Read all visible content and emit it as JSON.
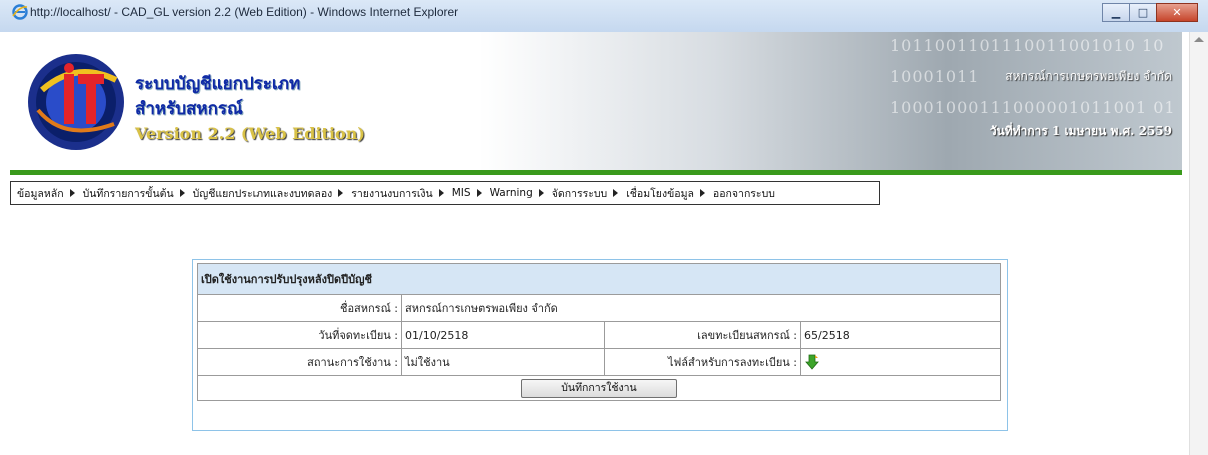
{
  "window": {
    "title": "http://localhost/ - CAD_GL version 2.2 (Web Edition) - Windows Internet Explorer",
    "controls": [
      "minimize",
      "maximize",
      "close"
    ]
  },
  "banner": {
    "title_line1": "ระบบบัญชีแยกประเภท",
    "title_line2": "สำหรับสหกรณ์",
    "version": "Version 2.2 (Web Edition)",
    "binary_row1": "1011001101110011001010 10",
    "binary_row2": "10001011",
    "binary_row3": "10001000111000001011001 01",
    "coop_name": "สหกรณ์การเกษตรพอเพียง จำกัด",
    "work_date": "วันที่ทำการ 1 เมษายน พ.ศ. 2559"
  },
  "menu": {
    "items": [
      "ข้อมูลหลัก",
      "บันทึกรายการขั้นต้น",
      "บัญชีแยกประเภทและงบทดลอง",
      "รายงานงบการเงิน",
      "MIS",
      "Warning",
      "จัดการระบบ",
      "เชื่อมโยงข้อมูล",
      "ออกจากระบบ"
    ]
  },
  "panel": {
    "title": "เปิดใช้งานการปรับปรุงหลังปิดปีบัญชี",
    "coop_label": "ชื่อสหกรณ์ :",
    "coop_value": "สหกรณ์การเกษตรพอเพียง จำกัด",
    "reg_date_label": "วันที่จดทะเบียน :",
    "reg_date_value": "01/10/2518",
    "reg_no_label": "เลขทะเบียนสหกรณ์ :",
    "reg_no_value": "65/2518",
    "status_label": "สถานะการใช้งาน :",
    "status_value": "ไม่ใช้งาน",
    "file_label": "ไฟล์สำหรับการลงทะเบียน :",
    "file_icon": "download-arrow-icon",
    "save_button": "บันทึกการใช้งาน"
  },
  "colors": {
    "accent_green": "#3a9a1c",
    "panel_header": "#d6e6f5",
    "panel_border": "#8ec3e8",
    "title_blue": "#0f2aa6",
    "version_gold": "#d9c247"
  }
}
